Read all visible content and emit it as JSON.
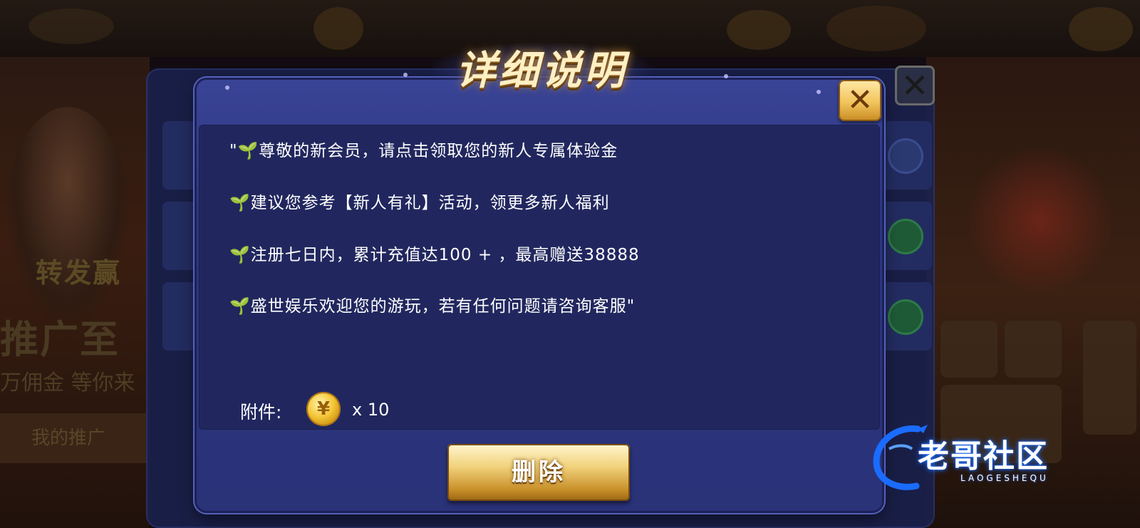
{
  "dialog": {
    "title": "详细说明",
    "message_lines": [
      "\"🌱尊敬的新会员，请点击领取您的新人专属体验金",
      "🌱建议您参考【新人有礼】活动，领更多新人福利",
      "🌱注册七日内，累计充值达100 + ，最高赠送38888",
      "🌱盛世娱乐欢迎您的游玩，若有任何问题请咨询客服\""
    ],
    "attachment_label": "附件:",
    "attachment_coin_symbol": "¥",
    "attachment_quantity": "x 10",
    "delete_label": "删除",
    "close_icon": "close-icon"
  },
  "background": {
    "promo_text_1": "转发赢",
    "promo_text_2": "推广至",
    "promo_text_3": "万佣金 等你来",
    "promo_button": "我的推广"
  },
  "watermark": {
    "text": "老哥社区",
    "sub": "LAOGESHEQU"
  },
  "colors": {
    "dialog_bg": "#2d3681",
    "content_bg": "#21275e",
    "title_gold": "#fff0c4",
    "button_gold": "#f1d27c",
    "watermark_blue": "#1a6cff"
  }
}
